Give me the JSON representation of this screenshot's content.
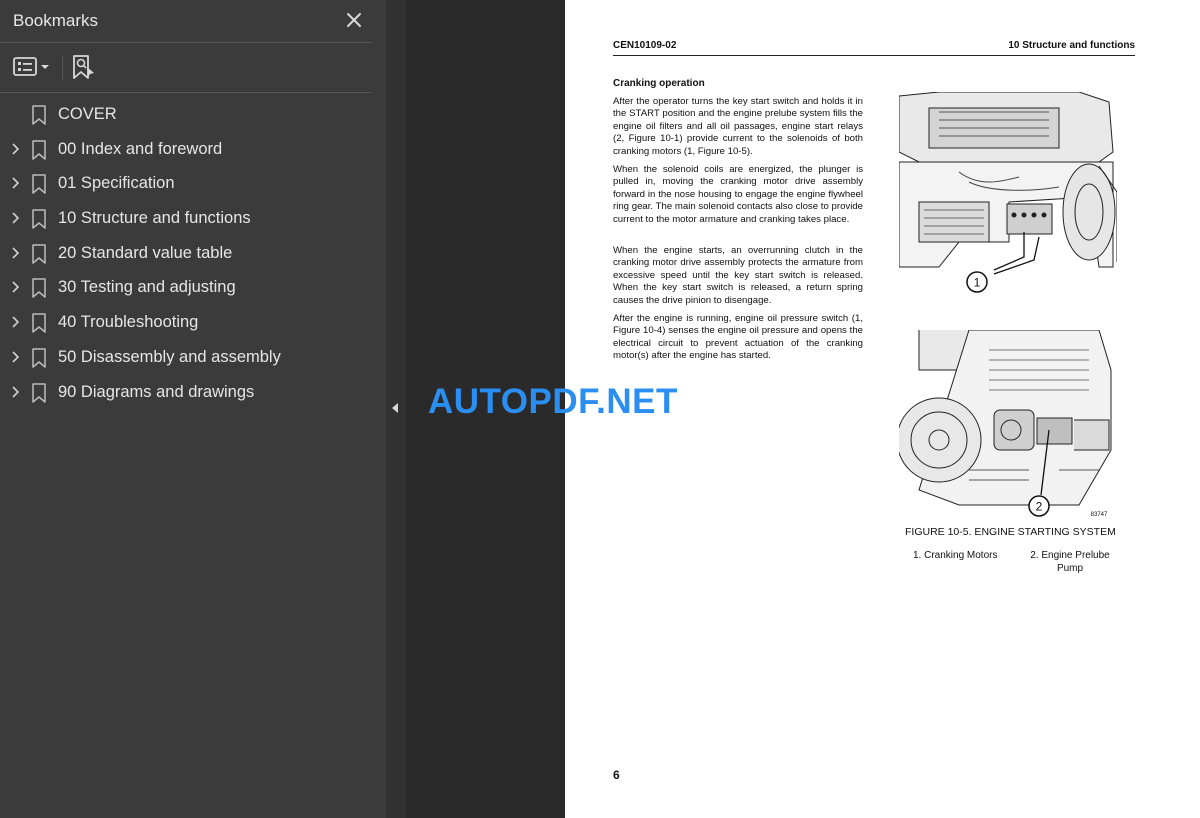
{
  "sidebar": {
    "title": "Bookmarks",
    "items": [
      {
        "label": "COVER",
        "expandable": false
      },
      {
        "label": "00 Index and foreword",
        "expandable": true
      },
      {
        "label": "01 Specification",
        "expandable": true
      },
      {
        "label": "10 Structure and functions",
        "expandable": true
      },
      {
        "label": "20 Standard value table",
        "expandable": true
      },
      {
        "label": "30 Testing and adjusting",
        "expandable": true
      },
      {
        "label": "40 Troubleshooting",
        "expandable": true
      },
      {
        "label": "50 Disassembly and assembly",
        "expandable": true
      },
      {
        "label": "90 Diagrams and drawings",
        "expandable": true
      }
    ]
  },
  "document": {
    "header_left": "CEN10109-02",
    "header_right": "10 Structure and functions",
    "section_title": "Cranking operation",
    "paragraphs": [
      "After the operator turns the key start switch and holds it in the START position and the engine prelube system fills the engine oil filters and all oil passages, engine start relays (2, Figure 10-1) provide current to the solenoids of both cranking motors (1, Figure 10-5).",
      "When the solenoid coils are energized, the plunger is pulled in, moving the cranking motor drive assembly forward in the nose housing to engage the engine flywheel ring gear. The main solenoid contacts also close to provide current to the motor armature and cranking takes place.",
      "When the engine starts, an overrunning clutch in the cranking motor drive assembly protects the armature from excessive speed until the key start switch is released. When the key start switch is released, a return spring causes the drive pinion to disengage.",
      "After the engine is running, engine oil pressure switch (1, Figure 10-4) senses the engine oil pressure and opens the electrical circuit to prevent actuation of the cranking motor(s) after the engine has started."
    ],
    "figure_callout_1": "1",
    "figure_callout_2": "2",
    "figure_code": "83747",
    "figure_caption": "FIGURE 10-5. ENGINE STARTING SYSTEM",
    "legend": [
      "1. Cranking Motors",
      "2. Engine Prelube Pump"
    ],
    "page_number": "6"
  },
  "watermark": "AUTOPDF.NET",
  "icons": {
    "close": "close-icon",
    "options": "list-options-icon",
    "find_bookmark": "find-bookmark-icon",
    "bookmark": "bookmark-icon",
    "chevron": "chevron-right-icon",
    "collapse": "collapse-left-icon"
  }
}
